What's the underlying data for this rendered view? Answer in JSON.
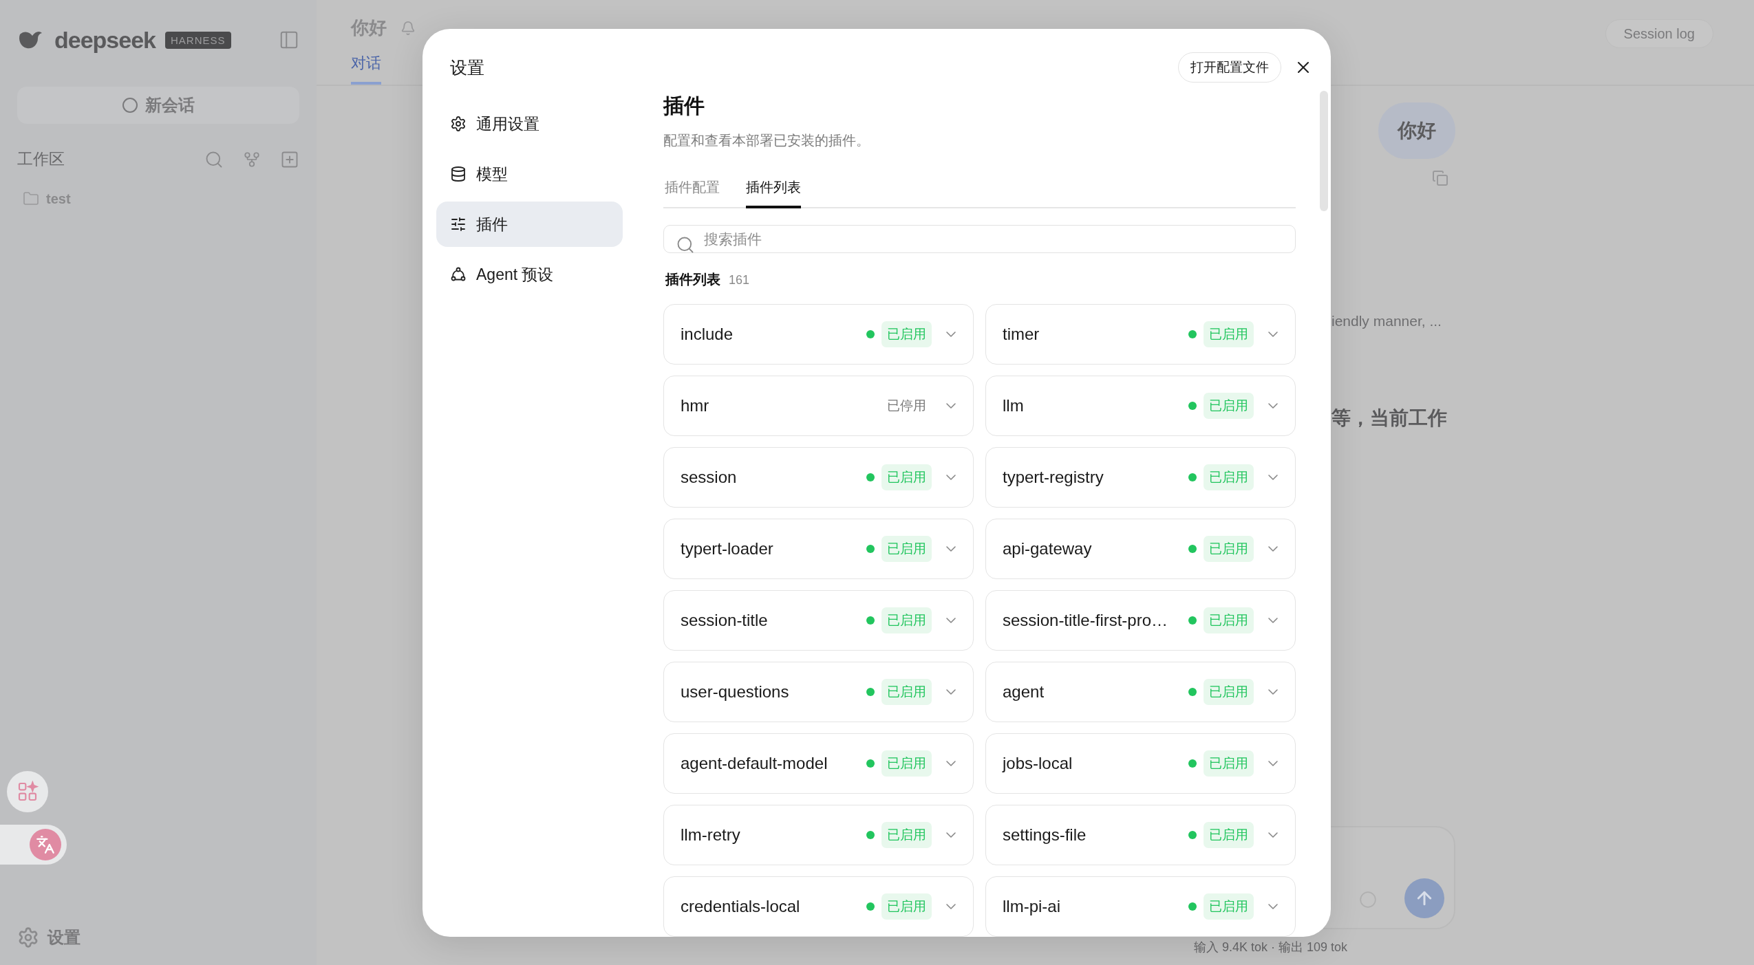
{
  "sidebar": {
    "logo_text": "deepseek",
    "logo_badge": "HARNESS",
    "new_chat": "新会话",
    "workspace_label": "工作区",
    "folders": [
      {
        "name": "test"
      }
    ],
    "settings": "设置"
  },
  "main": {
    "title_tab": "你好",
    "subtabs": [
      {
        "label": "对话",
        "selected": true
      }
    ],
    "session_log": "Session log",
    "user_message": "你好",
    "fragments": [
      {
        "text": "iendly manner, ...",
        "kind": "muted"
      },
      {
        "text": "等，当前工作",
        "kind": "strong"
      }
    ],
    "status": "输入 9.4K tok · 输出 109 tok"
  },
  "settings_dialog": {
    "title": "设置",
    "nav": [
      {
        "label": "通用设置",
        "selected": false
      },
      {
        "label": "模型",
        "selected": false
      },
      {
        "label": "插件",
        "selected": true
      },
      {
        "label": "Agent 预设",
        "selected": false
      }
    ],
    "open_config_button": "打开配置文件",
    "section_title": "插件",
    "section_description": "配置和查看本部署已安装的插件。",
    "tabs": [
      {
        "label": "插件配置",
        "selected": false
      },
      {
        "label": "插件列表",
        "selected": true
      }
    ],
    "search": {
      "placeholder": "搜索插件"
    },
    "list_title": "插件列表",
    "list_count": "161",
    "plugins": [
      {
        "name": "include",
        "enabled": true,
        "status": "已启用"
      },
      {
        "name": "timer",
        "enabled": true,
        "status": "已启用"
      },
      {
        "name": "hmr",
        "enabled": false,
        "status": "已停用"
      },
      {
        "name": "llm",
        "enabled": true,
        "status": "已启用"
      },
      {
        "name": "session",
        "enabled": true,
        "status": "已启用"
      },
      {
        "name": "typert-registry",
        "enabled": true,
        "status": "已启用"
      },
      {
        "name": "typert-loader",
        "enabled": true,
        "status": "已启用"
      },
      {
        "name": "api-gateway",
        "enabled": true,
        "status": "已启用"
      },
      {
        "name": "session-title",
        "enabled": true,
        "status": "已启用"
      },
      {
        "name": "session-title-first-pro…",
        "enabled": true,
        "status": "已启用"
      },
      {
        "name": "user-questions",
        "enabled": true,
        "status": "已启用"
      },
      {
        "name": "agent",
        "enabled": true,
        "status": "已启用"
      },
      {
        "name": "agent-default-model",
        "enabled": true,
        "status": "已启用"
      },
      {
        "name": "jobs-local",
        "enabled": true,
        "status": "已启用"
      },
      {
        "name": "llm-retry",
        "enabled": true,
        "status": "已启用"
      },
      {
        "name": "settings-file",
        "enabled": true,
        "status": "已启用"
      },
      {
        "name": "credentials-local",
        "enabled": true,
        "status": "已启用"
      },
      {
        "name": "llm-pi-ai",
        "enabled": true,
        "status": "已启用"
      }
    ]
  }
}
